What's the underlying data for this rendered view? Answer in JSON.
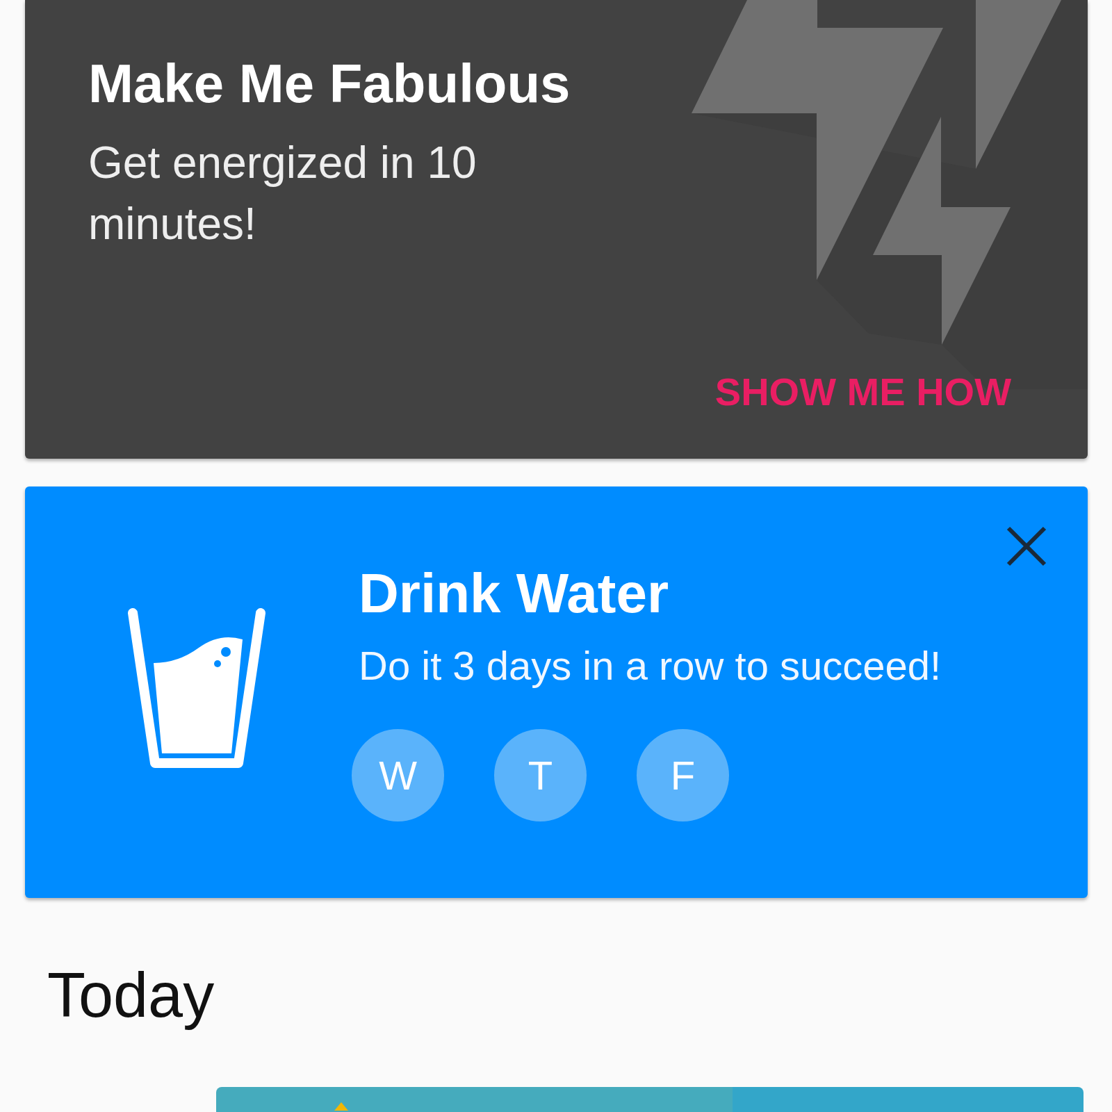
{
  "promo": {
    "title": "Make Me Fabulous",
    "subtitle": "Get energized in 10 minutes!",
    "action": "SHOW ME HOW"
  },
  "habit": {
    "title": "Drink Water",
    "subtitle": "Do it 3 days in a row to succeed!",
    "days": [
      "W",
      "T",
      "F"
    ]
  },
  "section": {
    "title": "Today"
  }
}
